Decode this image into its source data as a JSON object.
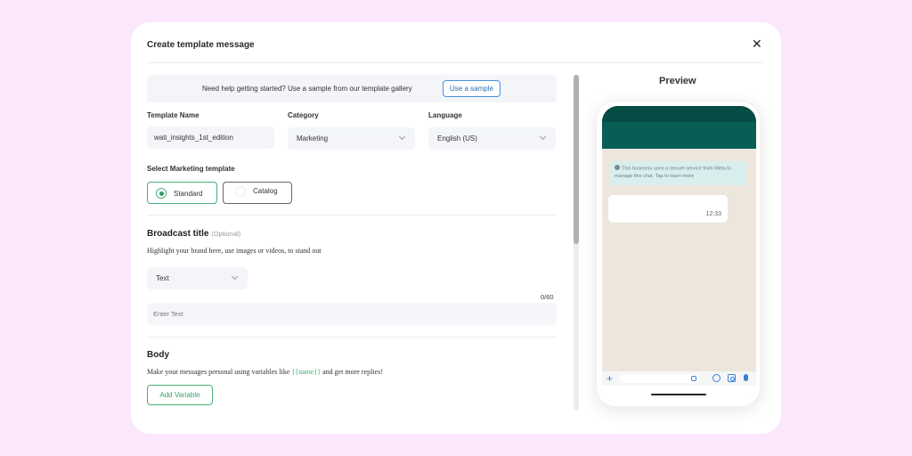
{
  "dialog": {
    "title": "Create template message",
    "close_icon": "close-icon"
  },
  "help_banner": {
    "text": "Need help getting started? Use a sample from our template gallery",
    "button_label": "Use a sample"
  },
  "form": {
    "template_name": {
      "label": "Template Name",
      "value": "wati_insights_1st_edition"
    },
    "category": {
      "label": "Category",
      "value": "Marketing"
    },
    "language": {
      "label": "Language",
      "value": "English (US)"
    },
    "marketing_template": {
      "label": "Select Marketing template",
      "options": [
        {
          "label": "Standard",
          "selected": true
        },
        {
          "label": "Catalog",
          "selected": false
        }
      ]
    }
  },
  "broadcast_title": {
    "title": "Broadcast title",
    "optional_label": "(Optional)",
    "description": "Highlight your brand here, use images or videos, to stand out",
    "type_value": "Text",
    "counter": "0/60",
    "input_placeholder": "Enter Text"
  },
  "body": {
    "title": "Body",
    "description_before": "Make your messages personal using variables like ",
    "variable_example": "{{name}}",
    "description_after": " and get more replies!",
    "add_variable_label": "Add Variable"
  },
  "preview": {
    "title": "Preview",
    "notice": "This business uses a secure service from Meta to manage this chat. Tap to learn more",
    "message_time": "12:33"
  },
  "colors": {
    "accent_green": "#4bb07a",
    "whatsapp_header": "#075e54",
    "link_blue": "#2b6fb8",
    "page_background": "#fbe8fd"
  }
}
